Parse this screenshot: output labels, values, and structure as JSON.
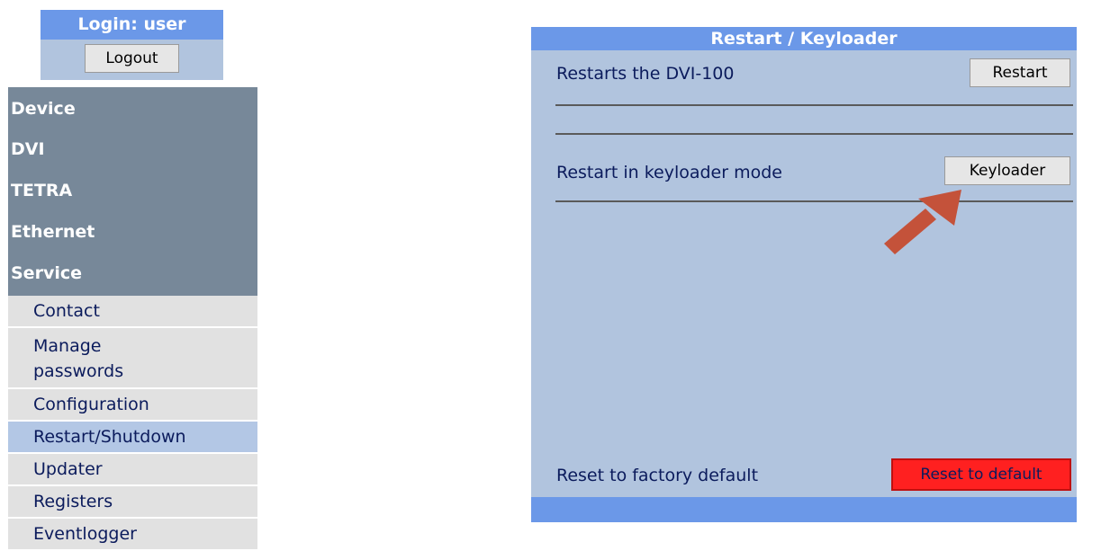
{
  "login": {
    "title": "Login: user",
    "logout_label": "Logout"
  },
  "sidebar": {
    "categories": [
      {
        "label": "Device"
      },
      {
        "label": "DVI"
      },
      {
        "label": "TETRA"
      },
      {
        "label": "Ethernet"
      },
      {
        "label": "Service"
      }
    ],
    "items": [
      {
        "label": "Contact"
      },
      {
        "label": "Manage\npasswords"
      },
      {
        "label": "Configuration"
      },
      {
        "label": "Restart/Shutdown"
      },
      {
        "label": "Updater"
      },
      {
        "label": "Registers"
      },
      {
        "label": "Eventlogger"
      }
    ],
    "active_item": "Restart/Shutdown"
  },
  "panel": {
    "title": "Restart / Keyloader",
    "restart_text": "Restarts the DVI-100",
    "restart_label": "Restart",
    "keyloader_text": "Restart in keyloader mode",
    "keyloader_label": "Keyloader",
    "reset_text": "Reset to factory default",
    "reset_label": "Reset to default"
  },
  "colors": {
    "header_blue": "#6b98e8",
    "panel_bg": "#b1c4de",
    "sidebar_gray": "#778899",
    "reset_red": "#ff2020",
    "arrow": "#c4523a"
  },
  "icons": {
    "annotation": "arrow-annotation-icon"
  }
}
